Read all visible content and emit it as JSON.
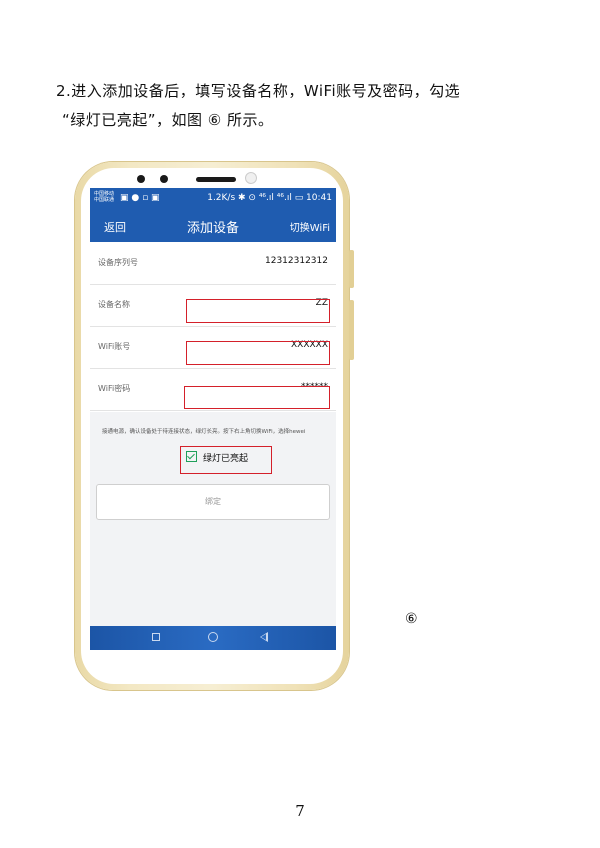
{
  "instructions": {
    "line1": "2.进入添加设备后，填写设备名称，WiFi账号及密码，勾选",
    "line2": "“绿灯已亮起”，如图 ⑥ 所示。"
  },
  "phone": {
    "status_bar": {
      "carrier": "中国移动\n中国联通",
      "left_icons": "▣ ● ▫ ▣",
      "right": "1.2K/s ✱ ⊙ ⁴⁶.ıl ⁴⁶.ıl ▭ 10:41"
    },
    "app_bar": {
      "back": "返回",
      "title": "添加设备",
      "switch_wifi": "切换WiFi"
    },
    "form": {
      "serial_label": "设备序列号",
      "serial_value": "12312312312",
      "name_label": "设备名称",
      "name_value": "ZZ",
      "wifi_account_label": "WiFi账号",
      "wifi_account_value": "XXXXXX",
      "wifi_password_label": "WiFi密码",
      "wifi_password_value": "******"
    },
    "hint": "接通电源，确认设备处于待连接状态，绿灯长亮。按下右上角切换WiFi，选择hewei",
    "checkbox_label": "绿灯已亮起",
    "bind_button": "绑定",
    "colors": {
      "app_blue": "#1f5cb0",
      "highlight_red": "#d4202a",
      "check_green": "#1fa05a"
    }
  },
  "figure_label": "⑥",
  "page_number": "7"
}
